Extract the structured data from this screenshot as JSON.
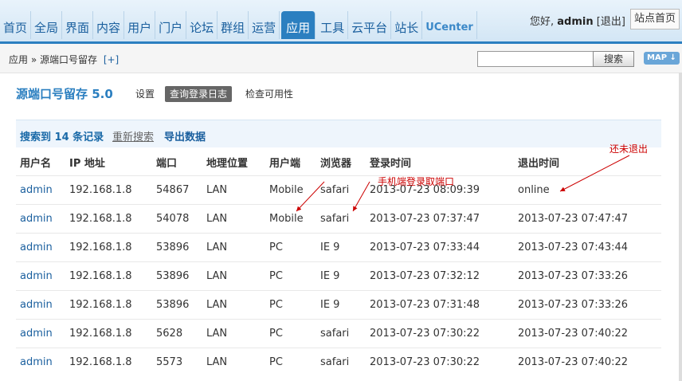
{
  "nav": {
    "items": [
      "首页",
      "全局",
      "界面",
      "内容",
      "用户",
      "门户",
      "论坛",
      "群组",
      "运营",
      "应用",
      "工具",
      "云平台",
      "站长",
      "UCenter"
    ],
    "active_index": 9
  },
  "user": {
    "greeting": "您好,",
    "name": "admin",
    "logout": "[退出]",
    "home_button": "站点首页"
  },
  "breadcrumb": {
    "path": "应用 » 源端口号留存",
    "add": "[+]"
  },
  "search": {
    "button": "搜索",
    "value": ""
  },
  "map_button": "MAP ↓",
  "plugin": {
    "title": "源端口号留存  5.0",
    "tabs": [
      "设置",
      "查询登录日志",
      "检查可用性"
    ],
    "active_tab": 1
  },
  "results": {
    "count_text": "搜索到 14 条记录",
    "research": "重新搜索",
    "export": "导出数据"
  },
  "table": {
    "columns": [
      "用户名",
      "IP 地址",
      "端口",
      "地理位置",
      "用户端",
      "浏览器",
      "登录时间",
      "退出时间"
    ],
    "rows": [
      [
        "admin",
        "192.168.1.8",
        "54867",
        "LAN",
        "Mobile",
        "safari",
        "2013-07-23 08:09:39",
        "online"
      ],
      [
        "admin",
        "192.168.1.8",
        "54078",
        "LAN",
        "Mobile",
        "safari",
        "2013-07-23 07:37:47",
        "2013-07-23 07:47:47"
      ],
      [
        "admin",
        "192.168.1.8",
        "53896",
        "LAN",
        "PC",
        "IE 9",
        "2013-07-23 07:33:44",
        "2013-07-23 07:43:44"
      ],
      [
        "admin",
        "192.168.1.8",
        "53896",
        "LAN",
        "PC",
        "IE 9",
        "2013-07-23 07:32:12",
        "2013-07-23 07:33:26"
      ],
      [
        "admin",
        "192.168.1.8",
        "53896",
        "LAN",
        "PC",
        "IE 9",
        "2013-07-23 07:31:48",
        "2013-07-23 07:33:26"
      ],
      [
        "admin",
        "192.168.1.8",
        "5628",
        "LAN",
        "PC",
        "safari",
        "2013-07-23 07:30:22",
        "2013-07-23 07:40:22"
      ],
      [
        "admin",
        "192.168.1.8",
        "5573",
        "LAN",
        "PC",
        "safari",
        "2013-07-23 07:30:22",
        "2013-07-23 07:40:22"
      ]
    ]
  },
  "annotations": {
    "not_logged_out": "还未退出",
    "mobile_port": "手机端登录取端口"
  },
  "colors": {
    "accent": "#2b7fc0",
    "annotation": "#cc0000"
  }
}
